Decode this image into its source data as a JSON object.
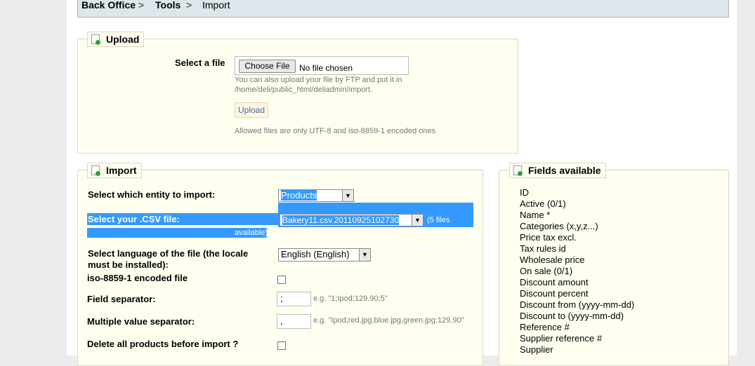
{
  "breadcrumb": {
    "items": [
      "Back Office",
      "Tools",
      "Import"
    ],
    "separator": ">"
  },
  "upload": {
    "legend": "Upload",
    "select_file_label": "Select a file",
    "choose_file_button": "Choose File",
    "no_file_text": "No file chosen",
    "ftp_hint": "You can also upload your file by FTP and put it in",
    "ftp_path": "/home/deli/public_html/deliadmin/import.",
    "upload_button": "Upload",
    "allowed_hint": "Allowed files are only UTF-8 and iso-8859-1 encoded ones"
  },
  "import": {
    "legend": "Import",
    "entity_label": "Select which entity to import:",
    "entity_value": "Products",
    "csv_label": "Select your .CSV file:",
    "csv_value": "Bakery11.csv.20110925102730",
    "csv_count": "(5 files",
    "csv_count_cont": "available)",
    "language_label_line1": "Select language of the file (the locale",
    "language_label_line2": "must be installed):",
    "language_value": "English (English)",
    "iso_label": "iso-8859-1 encoded file",
    "field_sep_label": "Field separator:",
    "field_sep_value": ";",
    "field_sep_hint": "e.g. \"1;Ipod;129.90;5\"",
    "multi_sep_label": "Multiple value separator:",
    "multi_sep_value": ",",
    "multi_sep_hint": "e.g. \"Ipod;red.jpg,blue.jpg,green.jpg;129.90\"",
    "delete_label": "Delete all products before import ?"
  },
  "fields_available": {
    "legend": "Fields available",
    "items": [
      "ID",
      "Active (0/1)",
      "Name *",
      "Categories (x,y,z...)",
      "Price tax excl.",
      "Tax rules id",
      "Wholesale price",
      "On sale (0/1)",
      "Discount amount",
      "Discount percent",
      "Discount from (yyyy-mm-dd)",
      "Discount to (yyyy-mm-dd)",
      "Reference #",
      "Supplier reference #",
      "Supplier"
    ]
  },
  "colors": {
    "selection": "#3399ff",
    "panel_bg": "#fffff0",
    "panel_border": "#dfd5c3",
    "breadcrumb_bg": "#dde6ea"
  }
}
